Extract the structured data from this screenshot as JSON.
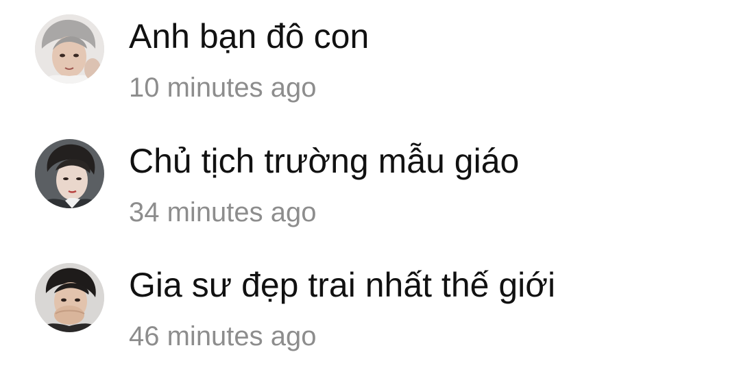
{
  "comments": [
    {
      "name": "Anh bạn đô con",
      "time": "10 minutes ago",
      "avatar_icon": "profile-photo"
    },
    {
      "name": "Chủ tịch trường mẫu giáo",
      "time": "34 minutes ago",
      "avatar_icon": "profile-photo"
    },
    {
      "name": "Gia sư đẹp trai nhất thế giới",
      "time": "46 minutes ago",
      "avatar_icon": "profile-photo"
    }
  ],
  "colors": {
    "background": "#ffffff",
    "name_text": "#111111",
    "time_text": "#8d8d8d"
  }
}
